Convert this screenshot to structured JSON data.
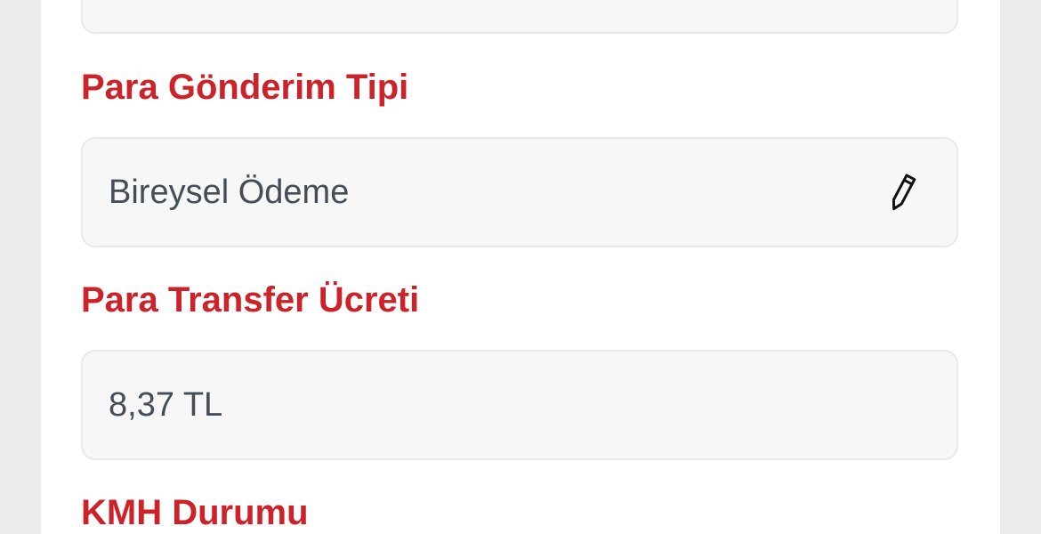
{
  "form": {
    "transfer_type": {
      "label": "Para Gönderim Tipi",
      "value": "Bireysel Ödeme",
      "edit_icon": "pencil-icon"
    },
    "transfer_fee": {
      "label": "Para Transfer Ücreti",
      "value": "8,37 TL"
    },
    "kmh_status": {
      "label": "KMH Durumu"
    }
  },
  "colors": {
    "label": "#cc2229",
    "value_text": "#454e56",
    "field_background": "#f7f7f7",
    "field_border": "#e9e9e9",
    "page_background": "#ebebeb",
    "panel_background": "#ffffff"
  }
}
